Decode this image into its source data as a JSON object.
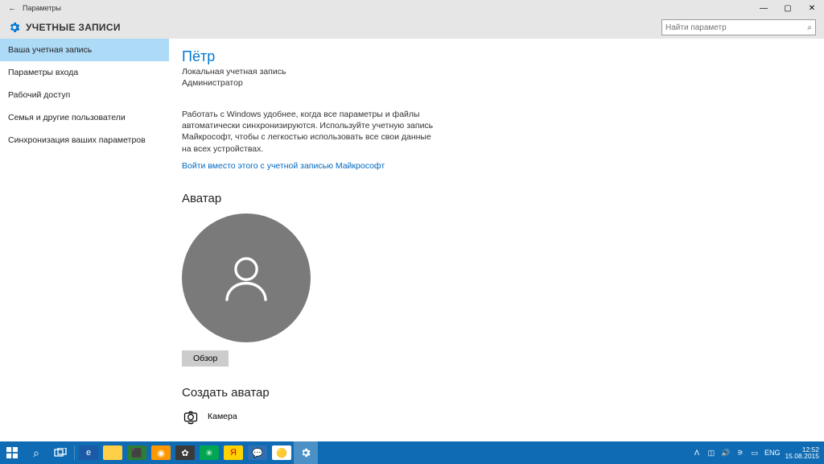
{
  "titlebar": {
    "title": "Параметры",
    "back_glyph": "←",
    "min": "—",
    "max": "▢",
    "close": "✕"
  },
  "header": {
    "title": "УЧЕТНЫЕ ЗАПИСИ"
  },
  "search": {
    "placeholder": "Найти параметр"
  },
  "sidebar": {
    "items": [
      {
        "label": "Ваша учетная запись",
        "active": true
      },
      {
        "label": "Параметры входа"
      },
      {
        "label": "Рабочий доступ"
      },
      {
        "label": "Семья и другие пользователи"
      },
      {
        "label": "Синхронизация ваших параметров"
      }
    ]
  },
  "account": {
    "name": "Пётр",
    "type": "Локальная учетная запись",
    "role": "Администратор",
    "description": "Работать с Windows удобнее, когда все параметры и файлы автоматически синхронизируются. Используйте учетную запись Майкрософт, чтобы с легкостью использовать все свои данные на всех устройствах.",
    "signin_link": "Войти вместо этого с учетной записью Майкрософт",
    "avatar_heading": "Аватар",
    "browse_label": "Обзор",
    "create_avatar_heading": "Создать аватар",
    "camera_label": "Камера"
  },
  "taskbar": {
    "tray": {
      "lang": "ENG",
      "time": "12:52",
      "date": "15.08.2015",
      "up_glyph": "ᐱ"
    }
  }
}
